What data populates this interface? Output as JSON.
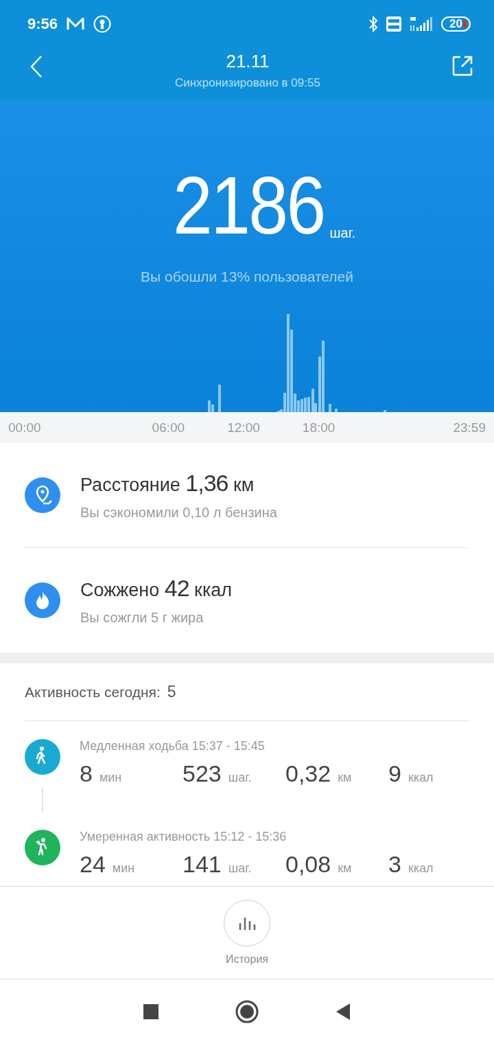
{
  "status_bar": {
    "time": "9:56",
    "battery": "20"
  },
  "header": {
    "title": "21.11",
    "subtitle": "Синхронизировано в 09:55"
  },
  "hero": {
    "steps": "2186",
    "unit": "шаг.",
    "comparison": "Вы обошли 13% пользователей"
  },
  "time_axis": [
    "00:00",
    "06:00",
    "12:00",
    "18:00",
    "23:59"
  ],
  "summary": [
    {
      "kind": "distance",
      "title": "Расстояние **1,36** км",
      "subtitle": "Вы сэкономили 0,10 л бензина"
    },
    {
      "kind": "calories",
      "title": "Сожжено **42** ккал",
      "subtitle": "Вы сожгли 5 г жира"
    }
  ],
  "activity": {
    "label": "Активность сегодня:",
    "count": "5",
    "items": [
      {
        "kind": "walk",
        "color": "#1aa9d0",
        "title": "Медленная ходьба 15:37 - 15:45",
        "stats": [
          {
            "value": "8",
            "unit": "мин"
          },
          {
            "value": "523",
            "unit": "шаг."
          },
          {
            "value": "0,32",
            "unit": "км"
          },
          {
            "value": "9",
            "unit": "ккал"
          }
        ]
      },
      {
        "kind": "moderate",
        "color": "#1fb35b",
        "title": "Умеренная активность 15:12 - 15:36",
        "stats": [
          {
            "value": "24",
            "unit": "мин"
          },
          {
            "value": "141",
            "unit": "шаг."
          },
          {
            "value": "0,08",
            "unit": "км"
          },
          {
            "value": "3",
            "unit": "ккал"
          }
        ]
      }
    ]
  },
  "bottom_button": {
    "label": "История"
  }
}
